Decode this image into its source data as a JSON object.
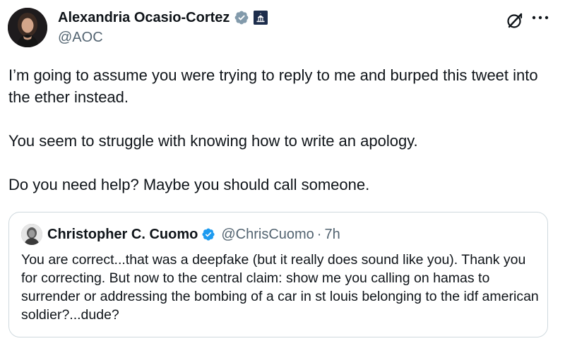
{
  "tweet": {
    "author_name": "Alexandria Ocasio-Cortez",
    "author_handle": "@AOC",
    "verified_badge": "gray-check-badge",
    "affiliation_badge": "capitol-building-icon",
    "text": "I’m going to assume you were trying to reply to me and burped this tweet into the ether instead.\n\nYou seem to struggle with knowing how to write an apology.\n\nDo you need help? Maybe you should call someone.",
    "actions": {
      "grok_icon": "grok-icon",
      "more_icon": "more-icon"
    }
  },
  "quoted_tweet": {
    "author_name": "Christopher C. Cuomo",
    "author_handle": "@ChrisCuomo",
    "separator": "·",
    "time": "7h",
    "verified_badge": "blue-check-badge",
    "text": "You are correct...that was a deepfake (but it really does sound like you). Thank you for correcting. But now to the central claim:  show me you calling on hamas to surrender or addressing the bombing of a car in st louis belonging to the idf american soldier?...dude?"
  },
  "colors": {
    "text_primary": "#0f1419",
    "text_secondary": "#536471",
    "verified_blue": "#1d9bf0",
    "verified_gray": "#829aab",
    "border": "#cfd9de"
  }
}
